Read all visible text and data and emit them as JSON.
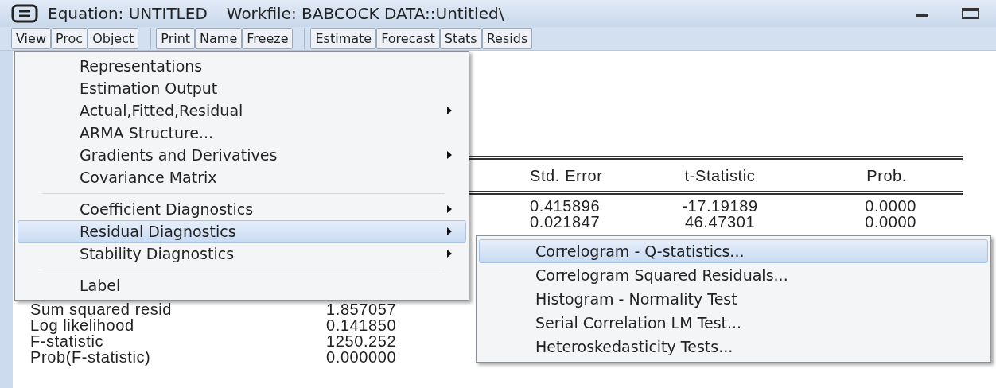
{
  "window": {
    "title": "Equation: UNTITLED",
    "workfile": "Workfile: BABCOCK DATA::Untitled\\"
  },
  "toolbar": [
    [
      "View",
      "Proc",
      "Object"
    ],
    [
      "Print",
      "Name",
      "Freeze"
    ],
    [
      "Estimate",
      "Forecast",
      "Stats",
      "Resids"
    ]
  ],
  "table": {
    "columns": [
      "Std. Error",
      "t-Statistic",
      "Prob."
    ],
    "rows": [
      [
        "0.415896",
        "-17.19189",
        "0.0000"
      ],
      [
        "0.021847",
        "46.47301",
        "0.0000"
      ]
    ]
  },
  "statistics": [
    {
      "label": "Sum squared resid",
      "value": "1.857057"
    },
    {
      "label": "Log likelihood",
      "value": "0.141850"
    },
    {
      "label": "F-statistic",
      "value": "1250.252"
    },
    {
      "label": "Prob(F-statistic)",
      "value": "0.000000"
    }
  ],
  "view_menu": {
    "items": [
      {
        "kind": "item",
        "label": "Representations",
        "submenu": false,
        "selected": false
      },
      {
        "kind": "item",
        "label": "Estimation Output",
        "submenu": false,
        "selected": false
      },
      {
        "kind": "item",
        "label": "Actual,Fitted,Residual",
        "submenu": true,
        "selected": false
      },
      {
        "kind": "item",
        "label": "ARMA Structure...",
        "submenu": false,
        "selected": false
      },
      {
        "kind": "item",
        "label": "Gradients and Derivatives",
        "submenu": true,
        "selected": false
      },
      {
        "kind": "item",
        "label": "Covariance Matrix",
        "submenu": false,
        "selected": false
      },
      {
        "kind": "separator"
      },
      {
        "kind": "item",
        "label": "Coefficient Diagnostics",
        "submenu": true,
        "selected": false
      },
      {
        "kind": "item",
        "label": "Residual Diagnostics",
        "submenu": true,
        "selected": true
      },
      {
        "kind": "item",
        "label": "Stability Diagnostics",
        "submenu": true,
        "selected": false
      },
      {
        "kind": "separator"
      },
      {
        "kind": "item",
        "label": "Label",
        "submenu": false,
        "selected": false
      }
    ]
  },
  "submenu": {
    "items": [
      {
        "label": "Correlogram - Q-statistics...",
        "selected": true
      },
      {
        "label": "Correlogram Squared Residuals...",
        "selected": false
      },
      {
        "label": "Histogram - Normality Test",
        "selected": false
      },
      {
        "label": "Serial Correlation LM Test...",
        "selected": false
      },
      {
        "label": "Heteroskedasticity Tests...",
        "selected": false
      }
    ]
  }
}
